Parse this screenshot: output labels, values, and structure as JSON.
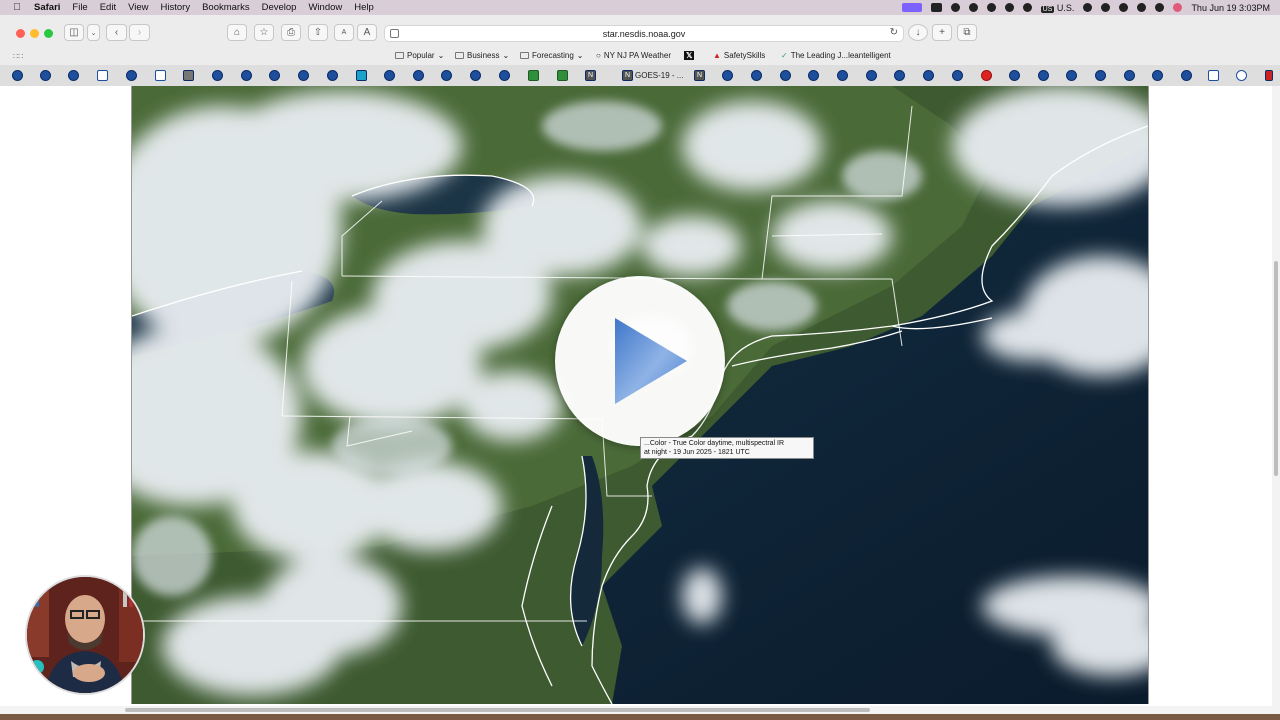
{
  "menubar": {
    "app": "Safari",
    "items": [
      "File",
      "Edit",
      "View",
      "History",
      "Bookmarks",
      "Develop",
      "Window",
      "Help"
    ],
    "input_source": "U.S.",
    "clock": "Thu Jun 19  3:03PM"
  },
  "toolbar": {
    "url": "star.nesdis.noaa.gov",
    "text_smaller": "A",
    "text_larger": "A"
  },
  "favorites": [
    {
      "label": "Popular",
      "type": "folder"
    },
    {
      "label": "Business",
      "type": "folder"
    },
    {
      "label": "Forecasting",
      "type": "folder"
    },
    {
      "label": "NY NJ PA Weather",
      "type": "globe"
    },
    {
      "label": "",
      "type": "x-logo"
    },
    {
      "label": "SafetySkills",
      "type": "site"
    },
    {
      "label": "The Leading J...leantelligent",
      "type": "check"
    }
  ],
  "tabs": {
    "active_title": "GOES-19 - ..."
  },
  "content": {
    "tooltip_line1": "...Color - True Color daytime, multispectral IR",
    "tooltip_line2": "at night - 19 Jun 2025 - 1821 UTC"
  },
  "colors": {
    "menubar": "#d9cdd8",
    "toolbar": "#ececec",
    "ocean": "#0d2236",
    "land": "#3b5a2e",
    "play_triangle": "#5b8bd6"
  },
  "icons": [
    "apple-icon",
    "sidebar-icon",
    "back-icon",
    "forward-icon",
    "home-icon",
    "star-icon",
    "print-icon",
    "share-icon",
    "reload-icon",
    "download-icon",
    "new-tab-icon",
    "tab-overview-icon",
    "play-icon"
  ]
}
